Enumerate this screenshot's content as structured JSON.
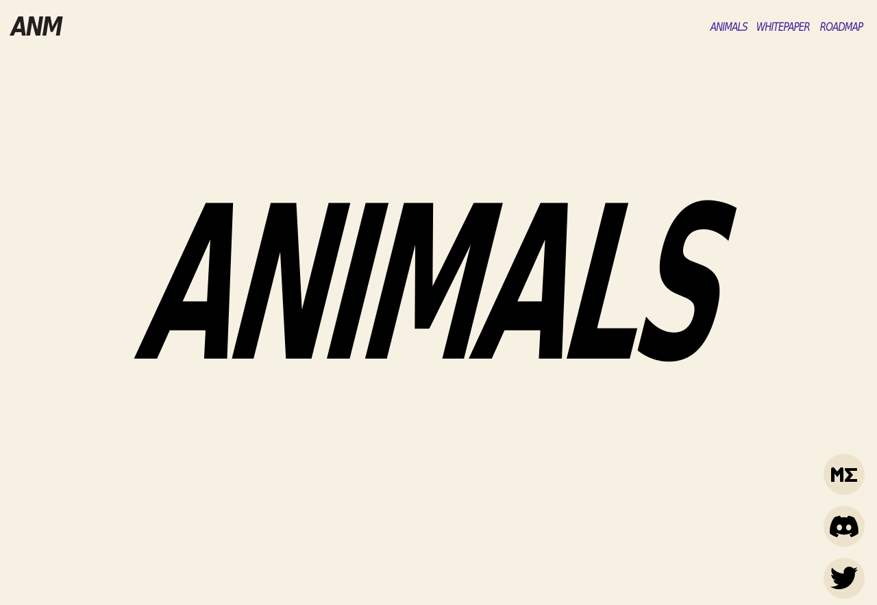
{
  "header": {
    "logo_text": "ANM"
  },
  "nav": {
    "items": [
      {
        "label": "ANIMALS"
      },
      {
        "label": "WHITEPAPER"
      },
      {
        "label": "ROADMAP"
      }
    ]
  },
  "hero": {
    "title": "ANIMALS"
  },
  "social": [
    {
      "icon": "magic-eden-icon"
    },
    {
      "icon": "discord-icon"
    },
    {
      "icon": "twitter-icon"
    }
  ],
  "colors": {
    "background": "#f7f1e3",
    "nav_link": "#3c1d99",
    "social_bg": "#ede3cd",
    "text": "#000000"
  }
}
